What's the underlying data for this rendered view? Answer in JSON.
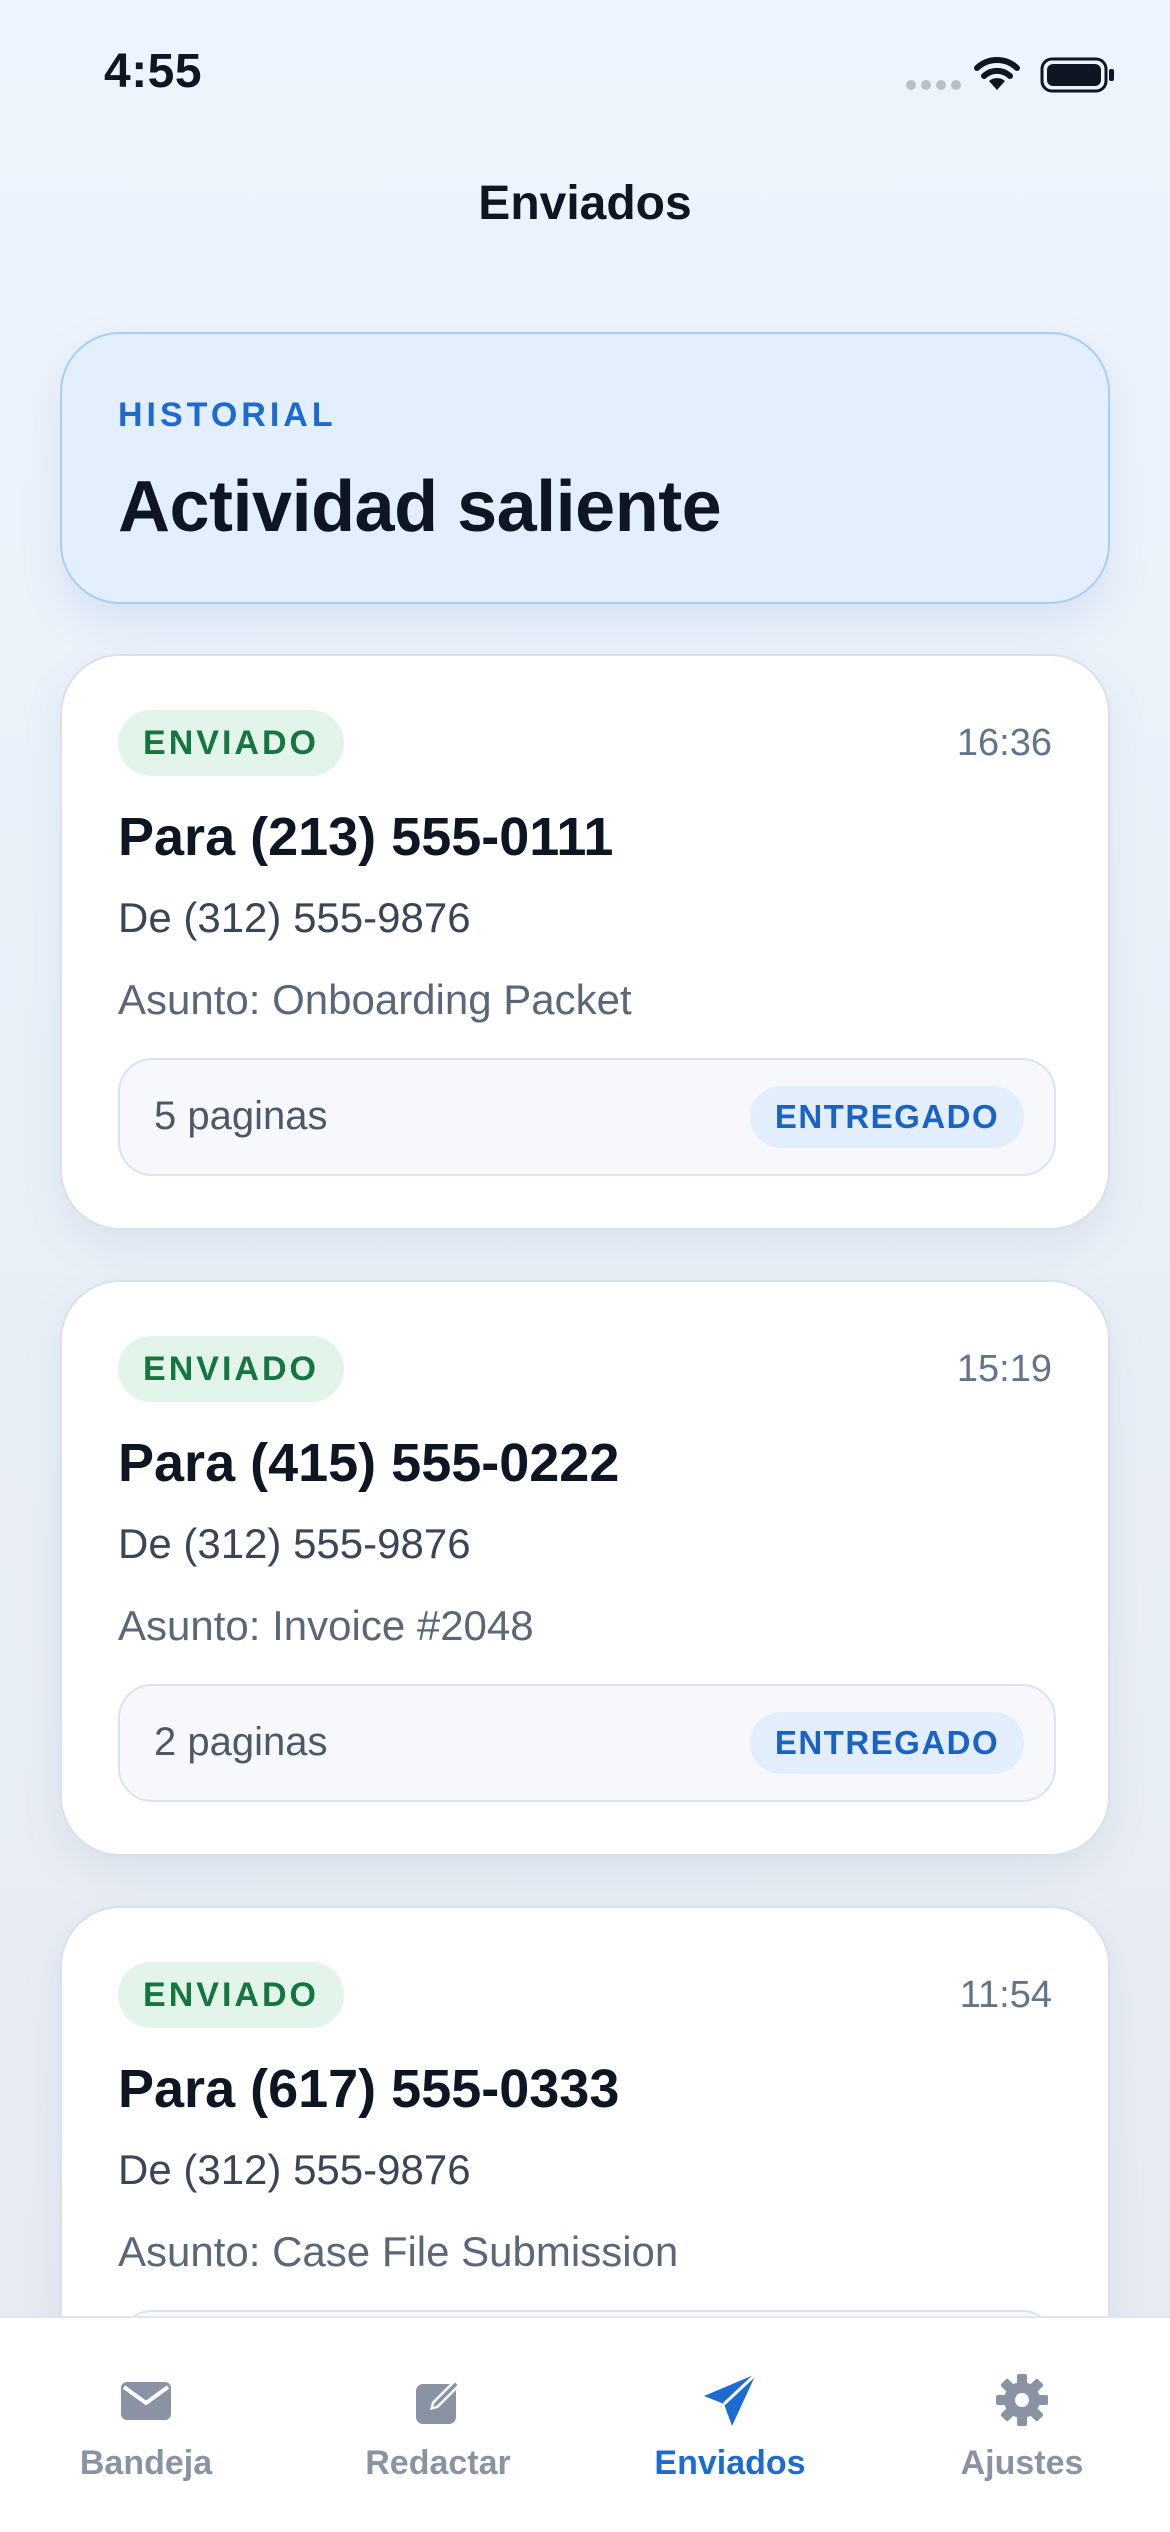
{
  "status_bar": {
    "time": "4:55"
  },
  "header": {
    "title": "Enviados"
  },
  "hero": {
    "overline": "HISTORIAL",
    "title": "Actividad saliente"
  },
  "faxes": [
    {
      "status": "ENVIADO",
      "time": "16:36",
      "to": "Para (213) 555-0111",
      "from": "De (312) 555-9876",
      "subject": "Asunto: Onboarding Packet",
      "pages": "5 paginas",
      "delivery": "ENTREGADO"
    },
    {
      "status": "ENVIADO",
      "time": "15:19",
      "to": "Para (415) 555-0222",
      "from": "De (312) 555-9876",
      "subject": "Asunto: Invoice #2048",
      "pages": "2 paginas",
      "delivery": "ENTREGADO"
    },
    {
      "status": "ENVIADO",
      "time": "11:54",
      "to": "Para (617) 555-0333",
      "from": "De (312) 555-9876",
      "subject": "Asunto: Case File Submission"
    }
  ],
  "tab_bar": {
    "items": [
      {
        "label": "Bandeja",
        "icon": "envelope-icon",
        "active": false
      },
      {
        "label": "Redactar",
        "icon": "compose-icon",
        "active": false
      },
      {
        "label": "Enviados",
        "icon": "paper-plane-icon",
        "active": true
      },
      {
        "label": "Ajustes",
        "icon": "gear-icon",
        "active": false
      }
    ]
  },
  "colors": {
    "accent": "#1d6bd0",
    "sent_badge_text": "#16763f",
    "sent_badge_bg": "#e3f4ea",
    "inactive_tab": "#8a93a3"
  }
}
